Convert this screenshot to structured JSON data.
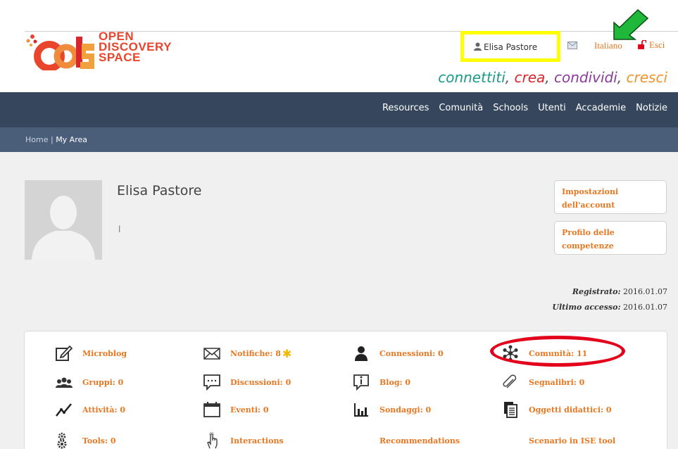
{
  "brand": {
    "line1": "OPEN",
    "line2": "DISCOVERY",
    "line3": "SPACE"
  },
  "topbar": {
    "user_name": "Elisa Pastore",
    "language": "Italiano",
    "logout": "Esci"
  },
  "tagline": {
    "w1": "connettiti",
    "w2": "crea",
    "w3": "condividi",
    "w4": "cresci",
    "sep": ", "
  },
  "nav": [
    "Resources",
    "Comunità",
    "Schools",
    "Utenti",
    "Accademie",
    "Notizie"
  ],
  "breadcrumb": {
    "home": "Home",
    "sep": " | ",
    "current": "My Area"
  },
  "profile": {
    "name": "Elisa Pastore",
    "bio": "l",
    "account_button": "Impostazioni dell'account",
    "competence_button": "Profilo delle competenze",
    "registered_label": "Registrato:",
    "registered_value": "2016.01.07",
    "last_access_label": "Ultimo accesso:",
    "last_access_value": "2016.01.07"
  },
  "menu": [
    {
      "label": "Microblog",
      "icon": "edit-icon"
    },
    {
      "label": "Notifiche: 8",
      "icon": "envelope-icon"
    },
    {
      "label": "Connessioni: 0",
      "icon": "person-icon"
    },
    {
      "label": "Comunità: 11",
      "icon": "snowflake-icon"
    },
    {
      "label": "Gruppi: 0",
      "icon": "group-icon"
    },
    {
      "label": "Discussioni: 0",
      "icon": "chat-icon"
    },
    {
      "label": "Blog: 0",
      "icon": "blog-icon"
    },
    {
      "label": "Segnalibri: 0",
      "icon": "paperclip-icon"
    },
    {
      "label": "Attività: 0",
      "icon": "activity-icon"
    },
    {
      "label": "Eventi: 0",
      "icon": "calendar-icon"
    },
    {
      "label": "Sondaggi: 0",
      "icon": "bar-chart-icon"
    },
    {
      "label": "Oggetti didattici: 0",
      "icon": "documents-icon"
    },
    {
      "label": "Tools: 0",
      "icon": "gears-icon"
    },
    {
      "label": "Interactions",
      "icon": "hand-pointer-icon"
    },
    {
      "label": "Recommendations",
      "icon": ""
    },
    {
      "label": "Scenario in ISE tool",
      "icon": ""
    }
  ],
  "colors": {
    "accent": "#e87722",
    "nav_bg": "#36465d",
    "crumb_bg": "#4a5e7a",
    "highlight_yellow": "#ffff00",
    "highlight_red": "#e3001b",
    "arrow_green": "#1fb83a"
  }
}
